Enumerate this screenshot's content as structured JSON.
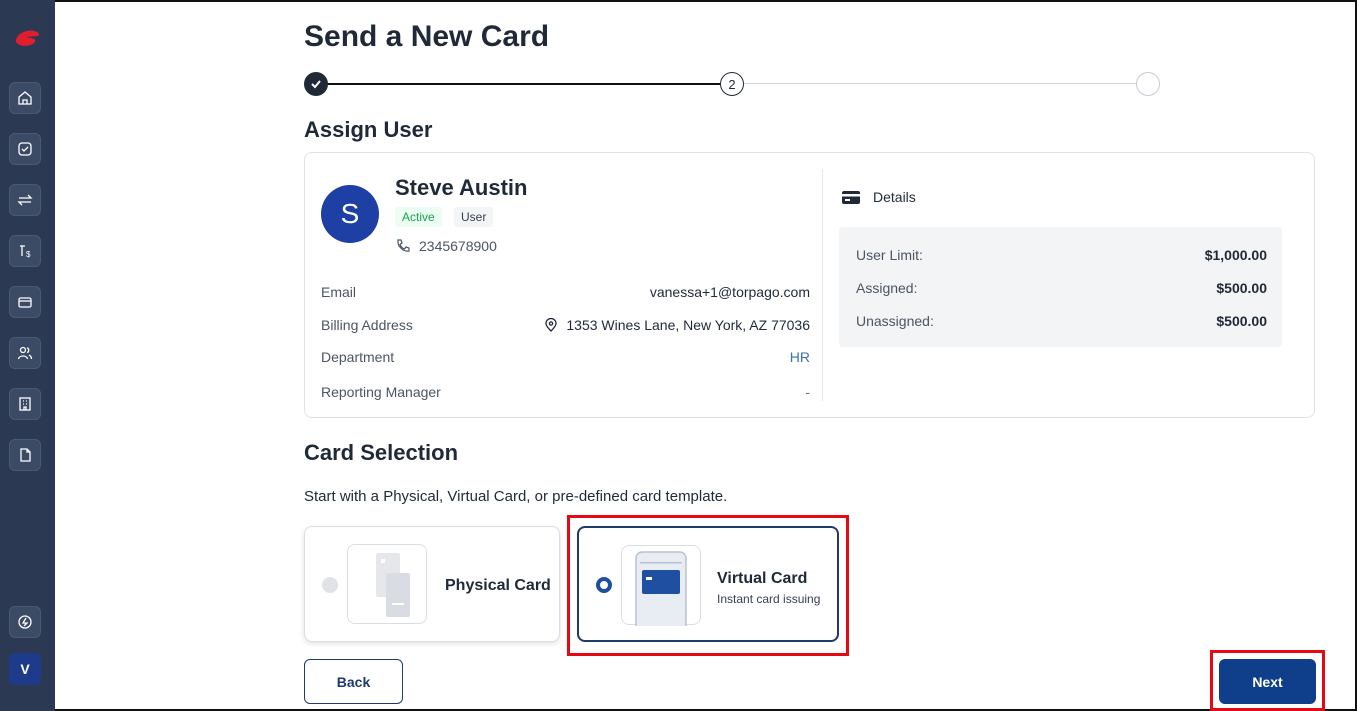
{
  "page_title": "Send a New Card",
  "stepper": {
    "step2_label": "2"
  },
  "assign_section": {
    "title": "Assign User"
  },
  "user": {
    "initial": "S",
    "name": "Steve Austin",
    "status": "Active",
    "role": "User",
    "phone": "2345678900",
    "email_label": "Email",
    "email": "vanessa+1@torpago.com",
    "billing_label": "Billing Address",
    "billing": "1353 Wines Lane, New York, AZ 77036",
    "department_label": "Department",
    "department": "HR",
    "manager_label": "Reporting Manager",
    "manager": "-"
  },
  "details": {
    "title": "Details",
    "rows": [
      {
        "label": "User Limit:",
        "value": "$1,000.00"
      },
      {
        "label": "Assigned:",
        "value": "$500.00"
      },
      {
        "label": "Unassigned:",
        "value": "$500.00"
      }
    ]
  },
  "card_section": {
    "title": "Card Selection",
    "subtitle": "Start with a Physical, Virtual Card, or pre-defined card template.",
    "physical_label": "Physical Card",
    "virtual_label": "Virtual Card",
    "virtual_sub": "Instant card issuing"
  },
  "buttons": {
    "back": "Back",
    "next": "Next"
  },
  "sidebar": {
    "avatar_initial": "V"
  },
  "colors": {
    "sidebar": "#2b3a52",
    "primary": "#0f3e8a",
    "highlight": "#e50914",
    "active_green": "#16a34a"
  }
}
